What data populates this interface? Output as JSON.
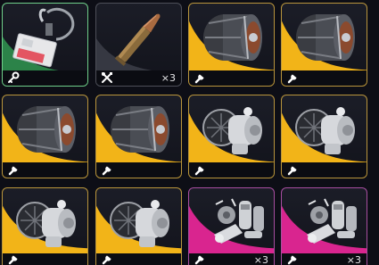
{
  "inventory": {
    "colors": {
      "common": "#2f8f4e",
      "plain": "#3a3c46",
      "legendary": "#f2b418",
      "epic": "#d9258f"
    },
    "slots": [
      {
        "item": "keycard-lanyard",
        "rarity": "common",
        "icons": [
          "key-icon"
        ],
        "qty": ""
      },
      {
        "item": "rifle-cartridge",
        "rarity": "plain",
        "icons": [
          "crossed-tools-icon"
        ],
        "qty": "×3"
      },
      {
        "item": "canister-engine",
        "rarity": "legendary",
        "icons": [
          "wrench-icon"
        ],
        "qty": ""
      },
      {
        "item": "canister-engine",
        "rarity": "legendary",
        "icons": [
          "wrench-icon"
        ],
        "qty": ""
      },
      {
        "item": "canister-engine",
        "rarity": "legendary",
        "icons": [
          "wrench-icon"
        ],
        "qty": ""
      },
      {
        "item": "canister-engine",
        "rarity": "legendary",
        "icons": [
          "wrench-icon"
        ],
        "qty": ""
      },
      {
        "item": "turbine-engine",
        "rarity": "legendary",
        "icons": [
          "wrench-icon"
        ],
        "qty": ""
      },
      {
        "item": "turbine-engine",
        "rarity": "legendary",
        "icons": [
          "wrench-icon"
        ],
        "qty": ""
      },
      {
        "item": "turbine-engine",
        "rarity": "legendary",
        "icons": [
          "wrench-icon"
        ],
        "qty": ""
      },
      {
        "item": "turbine-engine",
        "rarity": "legendary",
        "icons": [
          "wrench-icon"
        ],
        "qty": ""
      },
      {
        "item": "engine-parts-kit",
        "rarity": "epic",
        "icons": [
          "wrench-icon"
        ],
        "qty": "×3"
      },
      {
        "item": "engine-parts-kit",
        "rarity": "epic",
        "icons": [
          "wrench-icon"
        ],
        "qty": "×3"
      }
    ]
  }
}
